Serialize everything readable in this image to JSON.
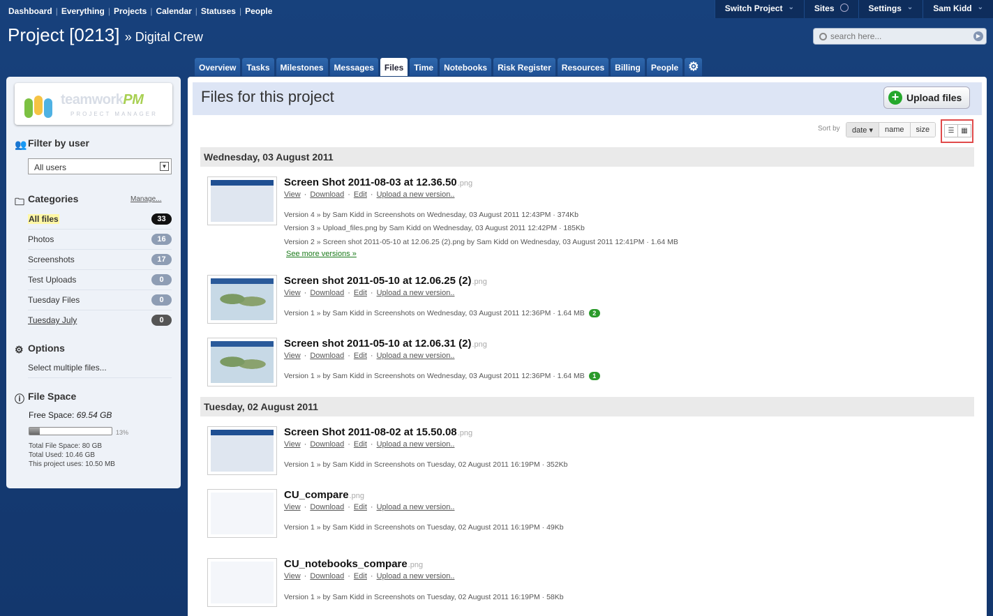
{
  "topnav": [
    "Dashboard",
    "Everything",
    "Projects",
    "Calendar",
    "Statuses",
    "People"
  ],
  "usermenu": {
    "switch_project": "Switch Project",
    "sites": "Sites",
    "settings": "Settings",
    "user": "Sam Kidd"
  },
  "project": {
    "name": "Project [0213]",
    "client": "» Digital Crew"
  },
  "search": {
    "placeholder": "search here..."
  },
  "tabs": [
    "Overview",
    "Tasks",
    "Milestones",
    "Messages",
    "Files",
    "Time",
    "Notebooks",
    "Risk Register",
    "Resources",
    "Billing",
    "People"
  ],
  "active_tab": "Files",
  "sidebar": {
    "logo_text": "teamwork",
    "logo_text_accent": "PM",
    "logo_sub": "PROJECT MANAGER",
    "filter_title": "Filter by user",
    "filter_value": "All users",
    "categories_title": "Categories",
    "manage_label": "Manage...",
    "categories": [
      {
        "label": "All files",
        "count": "33"
      },
      {
        "label": "Photos",
        "count": "16"
      },
      {
        "label": "Screenshots",
        "count": "17"
      },
      {
        "label": "Test Uploads",
        "count": "0"
      },
      {
        "label": "Tuesday Files",
        "count": "0"
      },
      {
        "label": "Tuesday July",
        "count": "0"
      }
    ],
    "options_title": "Options",
    "select_multiple": "Select multiple files...",
    "filespace_title": "File Space",
    "free_space_label": "Free Space:",
    "free_space_value": "69.54 GB",
    "usage_percent": 13,
    "usage_label": "13%",
    "total_space": "Total File Space: 80 GB",
    "total_used": "Total Used: 10.46 GB",
    "project_uses": "This project uses: 10.50 MB"
  },
  "main": {
    "title": "Files for this project",
    "upload_label": "Upload files",
    "sort_by": "Sort by",
    "sort_options": [
      "date",
      "name",
      "size"
    ],
    "groups": [
      {
        "date": "Wednesday, 03 August 2011",
        "files": [
          {
            "name": "Screen Shot 2011-08-03 at 12.36.50",
            "ext": ".png",
            "versions": [
              "Version 4 » by Sam Kidd in Screenshots on Wednesday, 03 August 2011 12:43PM · 374Kb",
              "Version 3 » Upload_files.png by Sam Kidd on Wednesday, 03 August 2011 12:42PM · 185Kb",
              "Version 2 » Screen shot 2011-05-10 at 12.06.25 (2).png by Sam Kidd on Wednesday, 03 August 2011 12:41PM · 1.64 MB"
            ],
            "see_more": "See more versions »"
          },
          {
            "name": "Screen shot 2011-05-10 at 12.06.25 (2)",
            "ext": ".png",
            "versions": [
              "Version 1 » by Sam Kidd in Screenshots on Wednesday, 03 August 2011 12:36PM · 1.64 MB"
            ],
            "comments": "2"
          },
          {
            "name": "Screen shot 2011-05-10 at 12.06.31 (2)",
            "ext": ".png",
            "versions": [
              "Version 1 » by Sam Kidd in Screenshots on Wednesday, 03 August 2011 12:36PM · 1.64 MB"
            ],
            "comments": "1"
          }
        ]
      },
      {
        "date": "Tuesday, 02 August 2011",
        "files": [
          {
            "name": "Screen Shot 2011-08-02 at 15.50.08",
            "ext": ".png",
            "versions": [
              "Version 1 » by Sam Kidd in Screenshots on Tuesday, 02 August 2011 16:19PM · 352Kb"
            ]
          },
          {
            "name": "CU_compare",
            "ext": ".png",
            "versions": [
              "Version 1 » by Sam Kidd in Screenshots on Tuesday, 02 August 2011 16:19PM · 49Kb"
            ]
          },
          {
            "name": "CU_notebooks_compare",
            "ext": ".png",
            "versions": [
              "Version 1 » by Sam Kidd in Screenshots on Tuesday, 02 August 2011 16:19PM · 58Kb"
            ]
          }
        ]
      }
    ],
    "file_actions": [
      "View",
      "Download",
      "Edit",
      "Upload a new version.."
    ]
  },
  "colors": {
    "brand": "#17417c",
    "accent_green": "#25a82c",
    "highlight": "#fff7a5",
    "toggle_border": "#e04a4a"
  }
}
